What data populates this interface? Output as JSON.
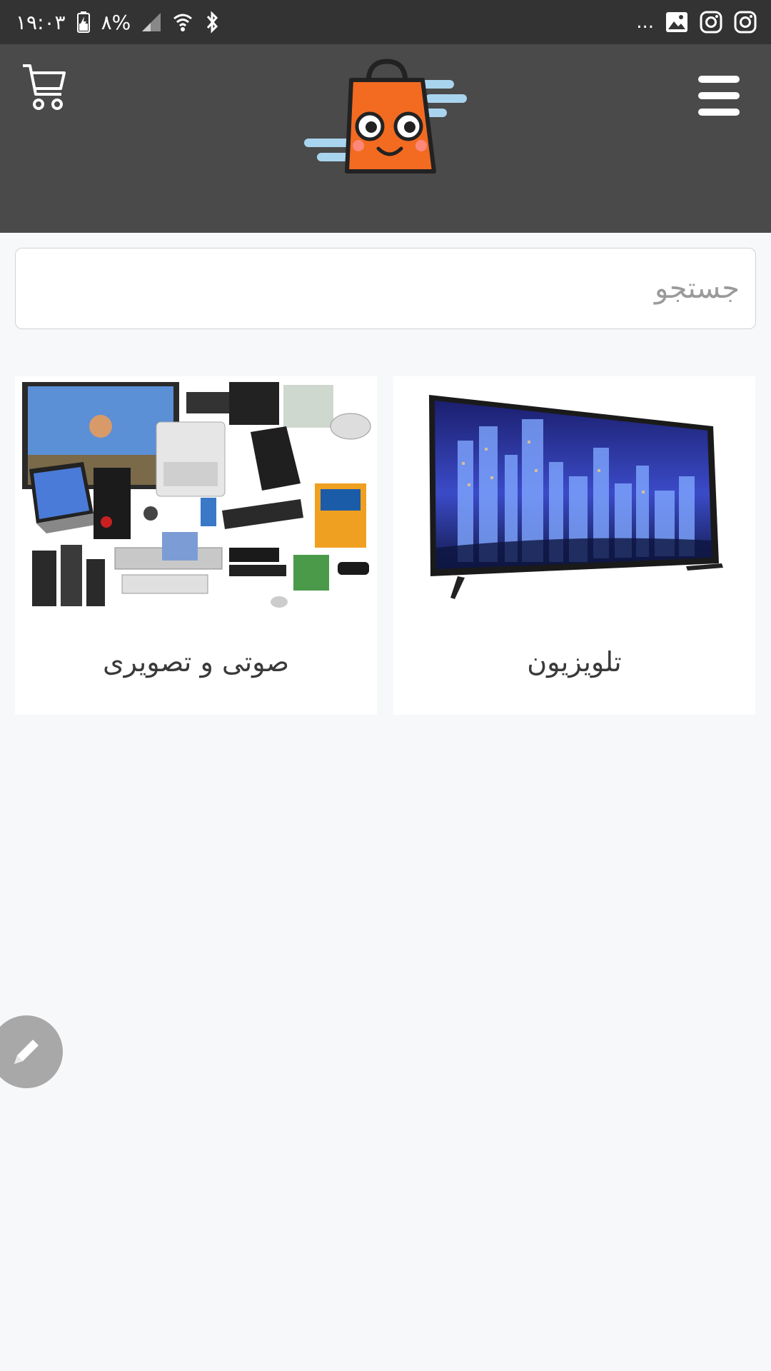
{
  "status_bar": {
    "time": "۱۹:۰۳",
    "battery": "۸%",
    "overflow": "...",
    "icons": [
      "battery-icon",
      "signal-icon",
      "wifi-icon",
      "bluetooth-icon",
      "gallery-icon",
      "instagram-icon",
      "instagram-icon"
    ]
  },
  "header": {
    "icons": [
      "cart-icon",
      "shopping-bag-logo",
      "hamburger-menu-icon"
    ],
    "colors": {
      "background": "#4a4a4a",
      "status_bar": "#333333",
      "logo_bag": "#f26b21",
      "logo_motion": "#a9d4ee"
    }
  },
  "search": {
    "placeholder": "جستجو",
    "value": ""
  },
  "categories": [
    {
      "title": "تلویزیون",
      "image": "television-image"
    },
    {
      "title": "صوتی و تصویری",
      "image": "electronics-collage-image"
    }
  ],
  "fab": {
    "icon": "pencil-icon"
  }
}
